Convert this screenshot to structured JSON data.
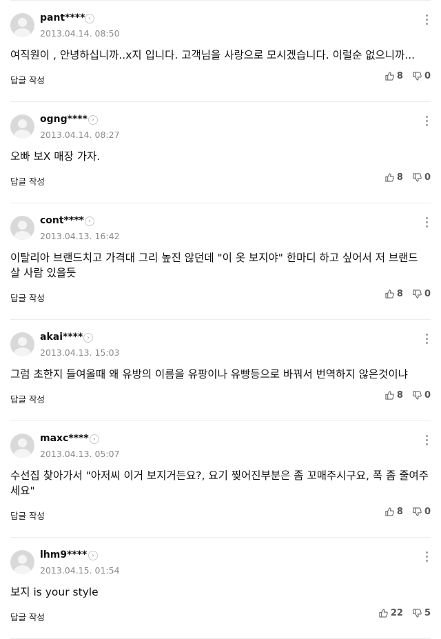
{
  "reply_label": "답글 작성",
  "comments": [
    {
      "user": "pant****",
      "date": "2013.04.14. 08:50",
      "text": "여직원이 , 안녕하십니까..x지 입니다. 고객님을 사랑으로 모시겠습니다. 이럴순 없으니까...",
      "likes": "8",
      "dislikes": "0"
    },
    {
      "user": "ogng****",
      "date": "2013.04.14. 08:27",
      "text": "오빠 보X 매장 가자.",
      "likes": "8",
      "dislikes": "0"
    },
    {
      "user": "cont****",
      "date": "2013.04.13. 16:42",
      "text": "이탈리아 브랜드치고 가격대 그리 높진 않던데 \"이 옷 보지야\" 한마디 하고 싶어서 저 브랜드 살 사람 있을듯",
      "likes": "8",
      "dislikes": "0"
    },
    {
      "user": "akai****",
      "date": "2013.04.13. 15:03",
      "text": "그럼 초한지 들여올때 왜 유방의 이름을 유팡이나 유빵등으로 바꿔서 번역하지 않은것이냐",
      "likes": "8",
      "dislikes": "0"
    },
    {
      "user": "maxc****",
      "date": "2013.04.13. 05:07",
      "text": "수선집 찾아가서 \"아저씨 이거 보지거든요?, 요기 찢어진부분은 좀 꼬매주시구요, 폭 좀 줄여주세요\"",
      "likes": "8",
      "dislikes": "0"
    },
    {
      "user": "lhm9****",
      "date": "2013.04.15. 01:54",
      "text": "보지 is your style",
      "likes": "22",
      "dislikes": "5"
    }
  ]
}
